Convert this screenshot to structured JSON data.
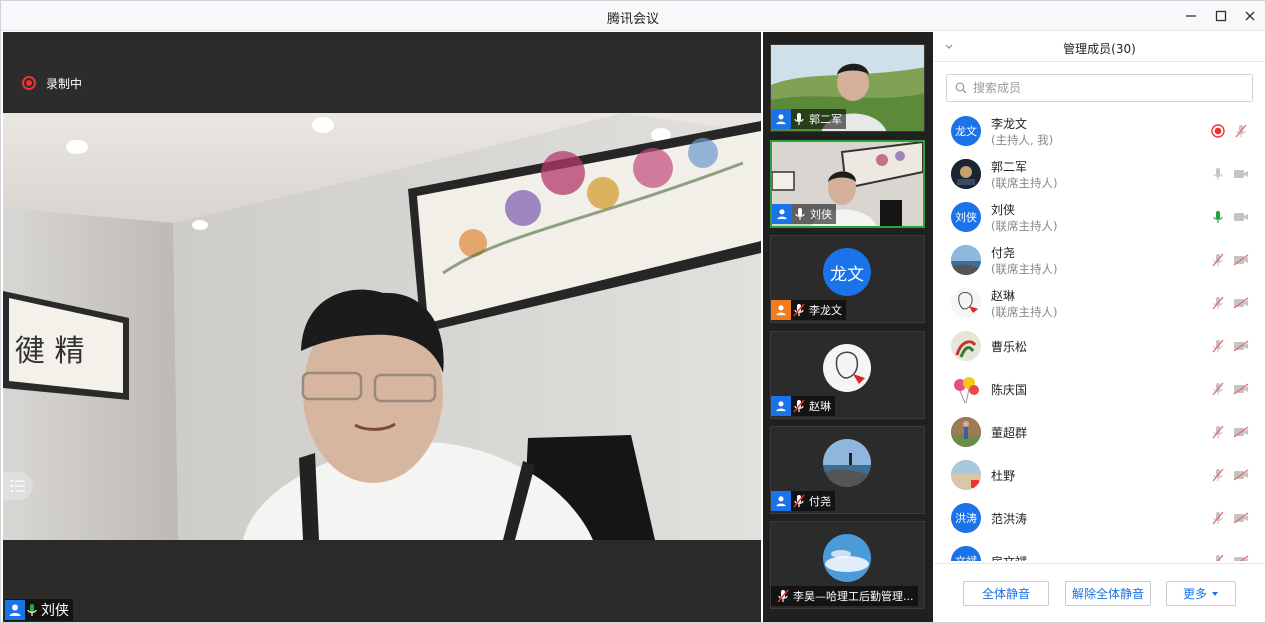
{
  "window": {
    "title": "腾讯会议"
  },
  "stage": {
    "recording_label": "录制中",
    "main_speaker": "刘侠"
  },
  "thumbnails": [
    {
      "name": "郭二军",
      "mic": "on",
      "kind": "video"
    },
    {
      "name": "刘侠",
      "mic": "on",
      "kind": "video",
      "active": true
    },
    {
      "name": "李龙文",
      "mic": "muted",
      "kind": "initials",
      "initials": "龙文"
    },
    {
      "name": "赵琳",
      "mic": "muted",
      "kind": "avatar"
    },
    {
      "name": "付尧",
      "mic": "muted",
      "kind": "avatar"
    },
    {
      "name": "李昊—哈理工后勤管理...",
      "mic": "muted",
      "kind": "avatar"
    }
  ],
  "panel": {
    "title": "管理成员(30)",
    "search_placeholder": "搜索成员",
    "members": [
      {
        "name": "李龙文",
        "role": "(主持人, 我)",
        "avatar_text": "龙文",
        "mic": "recording",
        "cam": "mic-muted"
      },
      {
        "name": "郭二军",
        "role": "(联席主持人)",
        "avatar_text": "",
        "mic": "on-gray",
        "cam": "cam-gray"
      },
      {
        "name": "刘侠",
        "role": "(联席主持人)",
        "avatar_text": "刘侠",
        "mic": "on-green",
        "cam": "cam-gray"
      },
      {
        "name": "付尧",
        "role": "(联席主持人)",
        "avatar_text": "",
        "mic": "muted",
        "cam": "cam-off"
      },
      {
        "name": "赵琳",
        "role": "(联席主持人)",
        "avatar_text": "",
        "mic": "muted",
        "cam": "cam-off"
      },
      {
        "name": "曹乐松",
        "role": "",
        "avatar_text": "",
        "mic": "muted",
        "cam": "cam-off"
      },
      {
        "name": "陈庆国",
        "role": "",
        "avatar_text": "",
        "mic": "muted",
        "cam": "cam-off"
      },
      {
        "name": "董超群",
        "role": "",
        "avatar_text": "",
        "mic": "muted",
        "cam": "cam-off"
      },
      {
        "name": "杜野",
        "role": "",
        "avatar_text": "",
        "mic": "muted",
        "cam": "cam-off"
      },
      {
        "name": "范洪涛",
        "role": "",
        "avatar_text": "洪涛",
        "mic": "muted",
        "cam": "cam-off"
      },
      {
        "name": "房文斌",
        "role": "",
        "avatar_text": "文斌",
        "mic": "muted",
        "cam": "cam-off"
      }
    ],
    "buttons": {
      "mute_all": "全体静音",
      "unmute_all": "解除全体静音",
      "more": "更多"
    }
  },
  "colors": {
    "accent": "#1a73e8",
    "active_border": "#2aa33b",
    "record": "#e33333"
  }
}
